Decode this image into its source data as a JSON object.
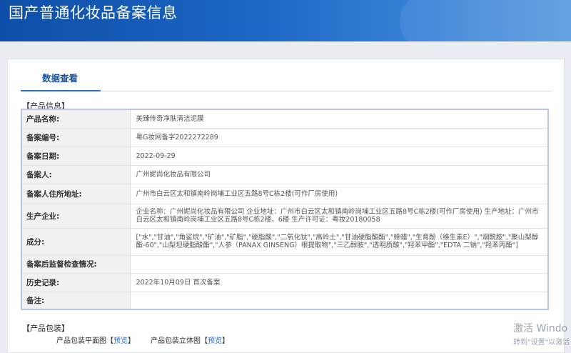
{
  "header": {
    "title": "国产普通化妆品备案信息"
  },
  "tabs": [
    {
      "label": "数据查看",
      "active": true
    }
  ],
  "product_section": {
    "title": "【产品信息】",
    "rows": [
      {
        "label": "产品名称:",
        "value": "美臻传奇净肤清洁泥膜"
      },
      {
        "label": "备案编号:",
        "value": "粤G妆网备字2022272289"
      },
      {
        "label": "备案日期:",
        "value": "2022-09-29"
      },
      {
        "label": "备案人:",
        "value": "广州妮尚化妆品有限公司"
      },
      {
        "label": "备案人住所地址:",
        "value": "广州市白云区太和镇南岭岗埔工业区五路8号C栋2楼(可作厂房使用)"
      },
      {
        "label": "生产企业:",
        "value": "企业名称：广州妮尚化妆品有限公司 企业地址：广州市白云区太和镇南岭岗埔工业区五路8号C栋2楼(可作厂房使用)  生产地址：广州市白云区太和镇南岭岗埔工业区五路8号C栋2楼、6楼 生产许可证：粤妆20180058"
      },
      {
        "label": "成分:",
        "value": "[\"水\",\"甘油\",\"角鲨烷\",\"矿油\",\"矿脂\",\"硬脂酸\",\"二氧化钛\",\"高岭土\",\"甘油硬脂酸酯\",\"蜂蜡\",\"生育酚（维生素E）\",\"烟酰胺\",\"聚山梨醇酯-60\",\"山梨坦硬脂酸酯\",\"人参（PANAX GINSENG）根提取物\",\"三乙醇胺\",\"透明质酸\",\"羟苯甲酯\",\"EDTA 二钠\",\"羟苯丙酯\"]"
      },
      {
        "label": "备案后监督检查情况:",
        "value": ""
      },
      {
        "label": "历史记录:",
        "value": "2022年10月09日 首次备案"
      },
      {
        "label": "备注:",
        "value": ""
      }
    ]
  },
  "packaging_section": {
    "title": "【产品包装】",
    "items": [
      {
        "label": "产品包装平面图",
        "link_label": "预览"
      },
      {
        "label": "产品包装立体图",
        "link_label": "预览"
      }
    ]
  },
  "os_watermark": {
    "line1": "激活 Windo",
    "line2": "转到\"设置\"以激活"
  }
}
